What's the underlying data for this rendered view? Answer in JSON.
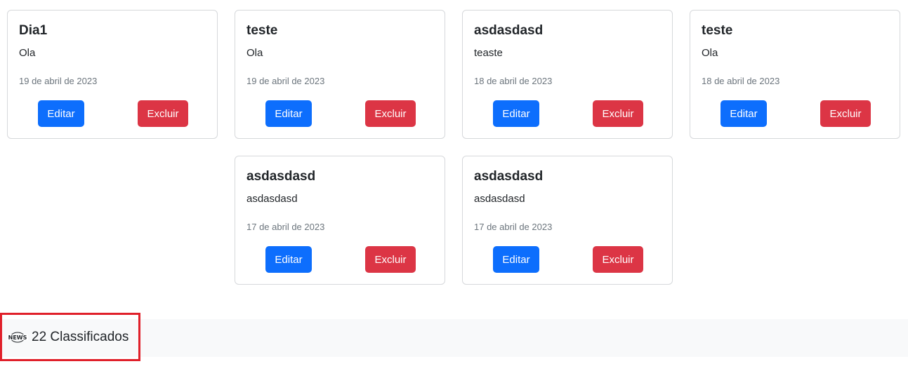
{
  "cards": [
    {
      "title": "Dia1",
      "text": "Ola",
      "date": "19 de abril de 2023",
      "edit_label": "Editar",
      "delete_label": "Excluir"
    },
    {
      "title": "teste",
      "text": "Ola",
      "date": "19 de abril de 2023",
      "edit_label": "Editar",
      "delete_label": "Excluir"
    },
    {
      "title": "asdasdasd",
      "text": "teaste",
      "date": "18 de abril de 2023",
      "edit_label": "Editar",
      "delete_label": "Excluir"
    },
    {
      "title": "teste",
      "text": "Ola",
      "date": "18 de abril de 2023",
      "edit_label": "Editar",
      "delete_label": "Excluir"
    },
    {
      "title": "asdasdasd",
      "text": "asdasdasd",
      "date": "17 de abril de 2023",
      "edit_label": "Editar",
      "delete_label": "Excluir"
    },
    {
      "title": "asdasdasd",
      "text": "asdasdasd",
      "date": "17 de abril de 2023",
      "edit_label": "Editar",
      "delete_label": "Excluir"
    }
  ],
  "footer": {
    "brand_icon": "news-icon",
    "brand_label": "22 Classificados",
    "icon_text": "NEWS"
  },
  "colors": {
    "edit_button": "#0d6efd",
    "delete_button": "#dc3545",
    "highlight_box": "#e0202a",
    "footer_background": "#f8f9fa"
  }
}
